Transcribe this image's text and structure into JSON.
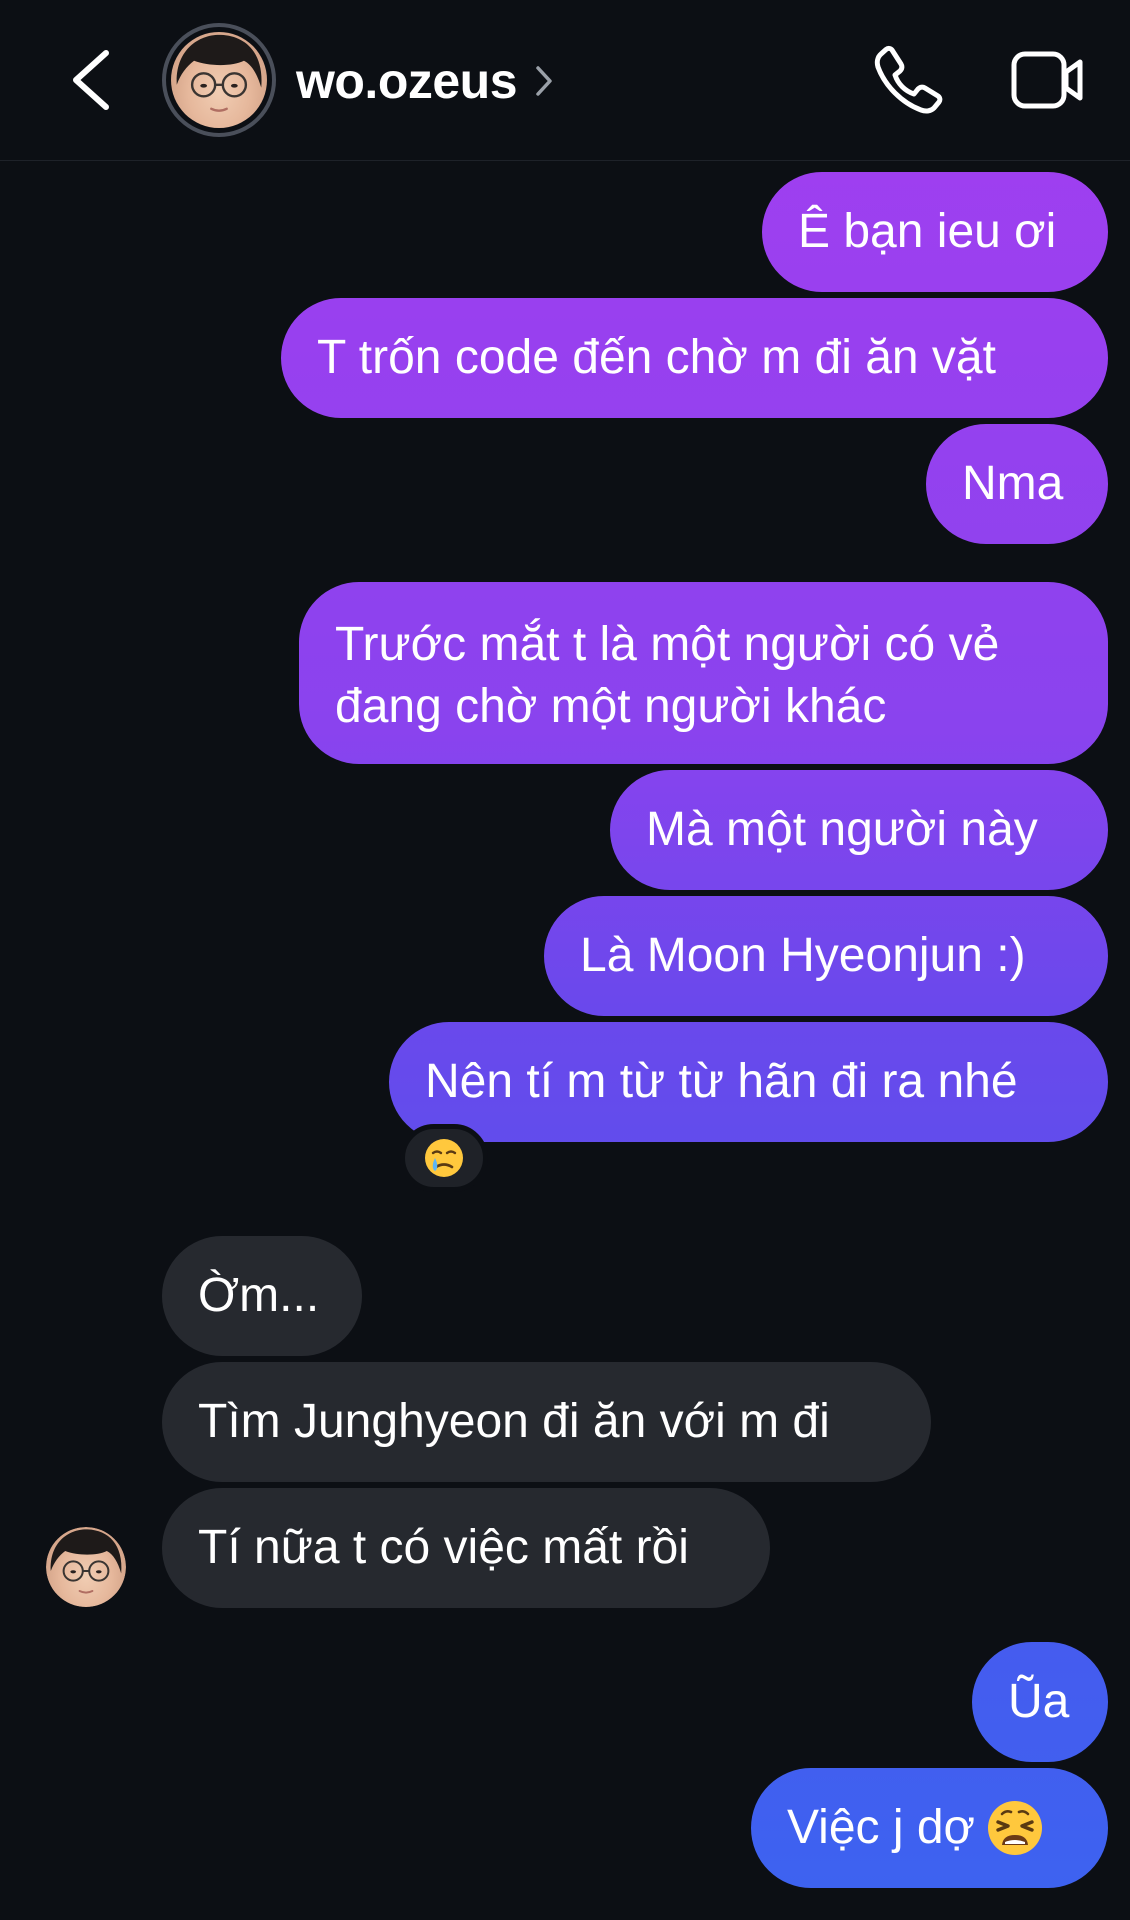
{
  "header": {
    "username": "wo.ozeus",
    "back_icon": "chevron-left-icon",
    "call_icon": "phone-icon",
    "video_icon": "video-camera-icon"
  },
  "colors": {
    "background": "#0c0f14",
    "sent_gradient_top": "#a43ef0",
    "sent_gradient_mid": "#6b48ec",
    "sent_gradient_bottom": "#3c63f0",
    "received_bubble": "#26292f",
    "text": "#ffffff"
  },
  "messages": [
    {
      "id": "m1",
      "direction": "sent",
      "text": "Ê bạn ieu ơi"
    },
    {
      "id": "m2",
      "direction": "sent",
      "text": "T trốn code đến chờ m đi ăn vặt"
    },
    {
      "id": "m3",
      "direction": "sent",
      "text": "Nma"
    },
    {
      "id": "m4",
      "direction": "sent",
      "text": "Trước mắt t là một người có vẻ đang chờ một người khác"
    },
    {
      "id": "m5",
      "direction": "sent",
      "text": "Mà một người này"
    },
    {
      "id": "m6",
      "direction": "sent",
      "text": "Là Moon Hyeonjun :)"
    },
    {
      "id": "m7",
      "direction": "sent",
      "text": "Nên tí m từ từ hãn đi ra nhé",
      "reaction": "crying-face-emoji"
    },
    {
      "id": "m8",
      "direction": "received",
      "text": "Ờm..."
    },
    {
      "id": "m9",
      "direction": "received",
      "text": "Tìm Junghyeon đi ăn với m đi"
    },
    {
      "id": "m10",
      "direction": "received",
      "text": "Tí nữa t có việc mất rồi"
    },
    {
      "id": "m11",
      "direction": "sent",
      "text": "Ũa"
    },
    {
      "id": "m12",
      "direction": "sent",
      "text": "Việc j dợ",
      "emoji": "weary-face-emoji"
    }
  ]
}
